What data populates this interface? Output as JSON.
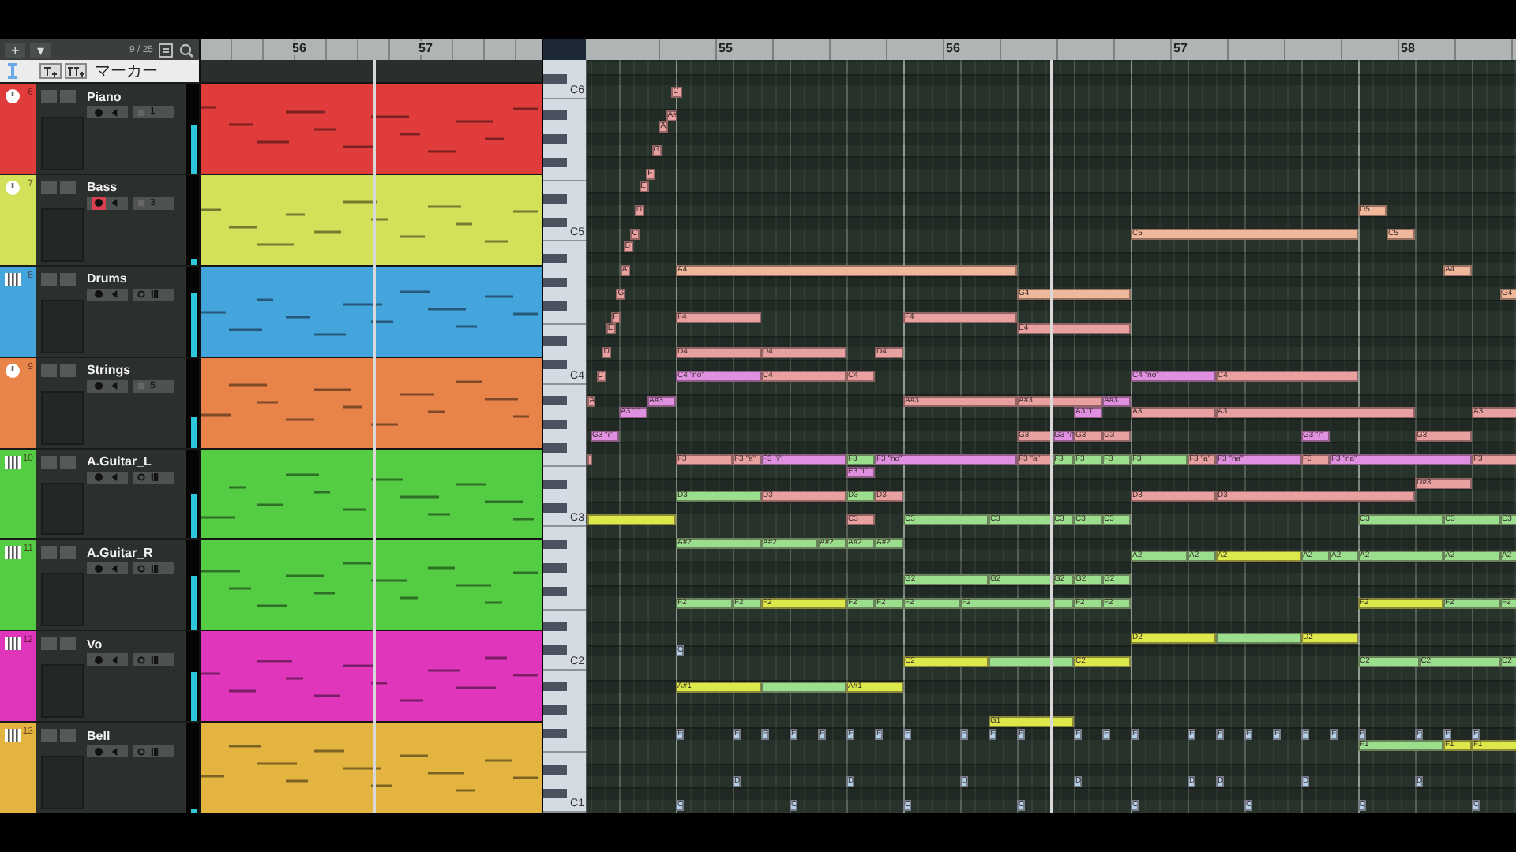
{
  "track_list": {
    "add_button": "+",
    "menu_button": "▾",
    "count": "9 / 25",
    "marker_track": {
      "name": "マーカー"
    },
    "tracks": [
      {
        "number": "6",
        "name": "Piano",
        "kind": "instrument",
        "color": "#e03c3c",
        "record": false,
        "channel": "1",
        "level": 0.55
      },
      {
        "number": "7",
        "name": "Bass",
        "kind": "instrument",
        "color": "#d2e05a",
        "record": true,
        "channel": "3",
        "level": 0.06
      },
      {
        "number": "8",
        "name": "Drums",
        "kind": "midi",
        "color": "#44a4dc",
        "record": false,
        "level": 0.7
      },
      {
        "number": "9",
        "name": "Strings",
        "kind": "instrument",
        "color": "#e8844a",
        "record": false,
        "channel": "5",
        "level": 0.35
      },
      {
        "number": "10",
        "name": "A.Guitar_L",
        "kind": "midi",
        "color": "#54cc44",
        "record": false,
        "level": 0.5
      },
      {
        "number": "11",
        "name": "A.Guitar_R",
        "kind": "midi",
        "color": "#54cc44",
        "record": false,
        "level": 0.6
      },
      {
        "number": "12",
        "name": "Vo",
        "kind": "midi",
        "color": "#e036bc",
        "record": false,
        "level": 0.55
      },
      {
        "number": "13",
        "name": "Bell",
        "kind": "midi",
        "color": "#e4b440",
        "record": false,
        "level": 0.04
      }
    ]
  },
  "arrangement": {
    "ruler": [
      "56",
      "57"
    ]
  },
  "piano_roll": {
    "ruler": [
      "55",
      "56",
      "57",
      "58"
    ],
    "keyboard": [
      "C6",
      "C5",
      "C4",
      "C3",
      "C2",
      "C1"
    ],
    "notes": [
      {
        "label": "C",
        "color": "#e8a0a0"
      },
      {
        "label": "A#",
        "color": "#e8a0a0"
      },
      {
        "label": "A",
        "color": "#e8a0a0"
      },
      {
        "label": "G",
        "color": "#e8a0a0"
      },
      {
        "label": "F",
        "color": "#e8a0a0"
      },
      {
        "label": "E",
        "color": "#e8a0a0"
      },
      {
        "label": "D",
        "color": "#e8a0a0"
      },
      {
        "label": "D5",
        "color": "#f0b89a"
      },
      {
        "label": "C",
        "color": "#e8a0a0"
      },
      {
        "label": "C5",
        "color": "#f0b89a"
      },
      {
        "label": "C5",
        "color": "#f0b89a"
      },
      {
        "label": "B",
        "color": "#e8a0a0"
      },
      {
        "label": "A",
        "color": "#e8a0a0"
      },
      {
        "label": "A4",
        "color": "#f0b89a"
      },
      {
        "label": "A4",
        "color": "#f0b89a"
      },
      {
        "label": "G",
        "color": "#e8a0a0"
      },
      {
        "label": "G4",
        "color": "#f0b89a"
      },
      {
        "label": "G4",
        "color": "#f0b89a"
      },
      {
        "label": "F",
        "color": "#e8a0a0"
      },
      {
        "label": "F4",
        "color": "#e8a0a0"
      },
      {
        "label": "F4",
        "color": "#e8a0a0"
      },
      {
        "label": "E",
        "color": "#e8a0a0"
      },
      {
        "label": "E4",
        "color": "#e8a0a0"
      },
      {
        "label": "D",
        "color": "#e8a0a0"
      },
      {
        "label": "D4",
        "color": "#e8a0a0"
      },
      {
        "label": "D4",
        "color": "#e8a0a0"
      },
      {
        "label": "D4",
        "color": "#e8a0a0"
      },
      {
        "label": "C",
        "color": "#e8a0a0"
      },
      {
        "label": "C4 \"no\"",
        "color": "#e090e0"
      },
      {
        "label": "C4",
        "color": "#e8a0a0"
      },
      {
        "label": "C4",
        "color": "#e8a0a0"
      },
      {
        "label": "C4 \"no\"",
        "color": "#e090e0"
      },
      {
        "label": "C4",
        "color": "#e8a0a0"
      },
      {
        "label": "A",
        "color": "#e8a0a0"
      },
      {
        "label": "A#3",
        "color": "#e090e0"
      },
      {
        "label": "A#3",
        "color": "#e8a0a0"
      },
      {
        "label": "A#3",
        "color": "#e8a0a0"
      },
      {
        "label": "A#3",
        "color": "#e090e0"
      },
      {
        "label": "A3 \"i\"",
        "color": "#e090e0"
      },
      {
        "label": "A3 \"i\"",
        "color": "#e090e0"
      },
      {
        "label": "A3",
        "color": "#e8a0a0"
      },
      {
        "label": "A3",
        "color": "#e8a0a0"
      },
      {
        "label": "A3",
        "color": "#e8a0a0"
      },
      {
        "label": "G3 \"i\"",
        "color": "#e090e0"
      },
      {
        "label": "G3",
        "color": "#e8a0a0"
      },
      {
        "label": "G3 \"i\"",
        "color": "#e090e0"
      },
      {
        "label": "G3",
        "color": "#e8a0a0"
      },
      {
        "label": "G3",
        "color": "#e8a0a0"
      },
      {
        "label": "G3 \"i\"",
        "color": "#e090e0"
      },
      {
        "label": "G3",
        "color": "#e8a0a0"
      },
      {
        "color": "#e8a0a0"
      },
      {
        "label": "F3",
        "color": "#e8a0a0"
      },
      {
        "label": "F3 \"a\"",
        "color": "#e8a0a0"
      },
      {
        "label": "F3 \"i\"",
        "color": "#e090e0"
      },
      {
        "label": "F3",
        "color": "#9ade8e"
      },
      {
        "label": "F3 \"no\"",
        "color": "#e090e0"
      },
      {
        "label": "F3 \"a\"",
        "color": "#e8a0a0"
      },
      {
        "label": "F3",
        "color": "#9ade8e"
      },
      {
        "label": "F3",
        "color": "#9ade8e"
      },
      {
        "label": "F3",
        "color": "#9ade8e"
      },
      {
        "label": "F3",
        "color": "#9ade8e"
      },
      {
        "label": "F3 \"a\"",
        "color": "#e8a0a0"
      },
      {
        "label": "F3 \"na\"",
        "color": "#e090e0"
      },
      {
        "label": "F3",
        "color": "#e8a0a0"
      },
      {
        "label": "F3 \"na\"",
        "color": "#e090e0"
      },
      {
        "label": "F3",
        "color": "#e8a0a0"
      },
      {
        "label": "E3 \"i\"",
        "color": "#e090e0"
      },
      {
        "label": "D#3",
        "color": "#e8a0a0"
      },
      {
        "label": "D3",
        "color": "#9ade8e"
      },
      {
        "label": "D3",
        "color": "#e8a0a0"
      },
      {
        "label": "D3",
        "color": "#9ade8e"
      },
      {
        "label": "D3",
        "color": "#e8a0a0"
      },
      {
        "label": "D3",
        "color": "#e8a0a0"
      },
      {
        "label": "D3",
        "color": "#e8a0a0"
      },
      {
        "color": "#dde84a"
      },
      {
        "label": "C3",
        "color": "#e8a0a0"
      },
      {
        "label": "C3",
        "color": "#9ade8e"
      },
      {
        "label": "C3",
        "color": "#9ade8e"
      },
      {
        "label": "C3",
        "color": "#9ade8e"
      },
      {
        "label": "C3",
        "color": "#9ade8e"
      },
      {
        "label": "C3",
        "color": "#9ade8e"
      },
      {
        "label": "C3",
        "color": "#9ade8e"
      },
      {
        "label": "C3",
        "color": "#9ade8e"
      },
      {
        "label": "C3",
        "color": "#9ade8e"
      },
      {
        "label": "A#2",
        "color": "#9ade8e"
      },
      {
        "label": "A#2",
        "color": "#9ade8e"
      },
      {
        "label": "A#2",
        "color": "#9ade8e"
      },
      {
        "label": "A#2",
        "color": "#9ade8e"
      },
      {
        "label": "A#2",
        "color": "#9ade8e"
      },
      {
        "label": "A2",
        "color": "#9ade8e"
      },
      {
        "label": "A2",
        "color": "#9ade8e"
      },
      {
        "label": "A2",
        "color": "#dde84a"
      },
      {
        "label": "A2",
        "color": "#9ade8e"
      },
      {
        "label": "A2",
        "color": "#9ade8e"
      },
      {
        "label": "A2",
        "color": "#9ade8e"
      },
      {
        "label": "A2",
        "color": "#9ade8e"
      },
      {
        "label": "A2",
        "color": "#9ade8e"
      },
      {
        "label": "G2",
        "color": "#9ade8e"
      },
      {
        "label": "G2",
        "color": "#9ade8e"
      },
      {
        "label": "G2",
        "color": "#9ade8e"
      },
      {
        "label": "G2",
        "color": "#9ade8e"
      },
      {
        "label": "G2",
        "color": "#9ade8e"
      },
      {
        "label": "F2",
        "color": "#9ade8e"
      },
      {
        "label": "F2",
        "color": "#9ade8e"
      },
      {
        "label": "F2",
        "color": "#dde84a"
      },
      {
        "label": "F2",
        "color": "#9ade8e"
      },
      {
        "label": "F2",
        "color": "#9ade8e"
      },
      {
        "label": "F2",
        "color": "#9ade8e"
      },
      {
        "label": "F2",
        "color": "#9ade8e"
      },
      {
        "color": "#9ade8e"
      },
      {
        "label": "F2",
        "color": "#9ade8e"
      },
      {
        "label": "F2",
        "color": "#9ade8e"
      },
      {
        "label": "F2",
        "color": "#dde84a"
      },
      {
        "label": "F2",
        "color": "#9ade8e"
      },
      {
        "label": "F2",
        "color": "#9ade8e"
      },
      {
        "label": "D2",
        "color": "#dde84a"
      },
      {
        "color": "#9ade8e"
      },
      {
        "label": "D2",
        "color": "#dde84a"
      },
      {
        "label": "C",
        "color": "#b4d0e8"
      },
      {
        "label": "C2",
        "color": "#dde84a"
      },
      {
        "color": "#9ade8e"
      },
      {
        "label": "C2",
        "color": "#dde84a"
      },
      {
        "label": "C2",
        "color": "#9ade8e"
      },
      {
        "label": "C2",
        "color": "#9ade8e"
      },
      {
        "label": "C2",
        "color": "#9ade8e"
      },
      {
        "label": "A#1",
        "color": "#dde84a"
      },
      {
        "color": "#9ade8e"
      },
      {
        "label": "A#1",
        "color": "#dde84a"
      },
      {
        "label": "G1",
        "color": "#dde84a"
      },
      {
        "label": "F",
        "color": "#b4d0e8"
      },
      {
        "label": "F",
        "color": "#b4d0e8"
      },
      {
        "label": "F",
        "color": "#b4d0e8"
      },
      {
        "label": "F",
        "color": "#b4d0e8"
      },
      {
        "label": "F",
        "color": "#b4d0e8"
      },
      {
        "label": "F",
        "color": "#b4d0e8"
      },
      {
        "label": "F",
        "color": "#b4d0e8"
      },
      {
        "label": "F",
        "color": "#b4d0e8"
      },
      {
        "label": "F",
        "color": "#b4d0e8"
      },
      {
        "label": "F",
        "color": "#b4d0e8"
      },
      {
        "label": "F",
        "color": "#b4d0e8"
      },
      {
        "label": "F",
        "color": "#b4d0e8"
      },
      {
        "label": "F",
        "color": "#b4d0e8"
      },
      {
        "label": "F",
        "color": "#b4d0e8"
      },
      {
        "label": "F",
        "color": "#b4d0e8"
      },
      {
        "label": "F",
        "color": "#b4d0e8"
      },
      {
        "label": "F",
        "color": "#b4d0e8"
      },
      {
        "label": "F",
        "color": "#b4d0e8"
      },
      {
        "label": "F",
        "color": "#b4d0e8"
      },
      {
        "label": "F",
        "color": "#b4d0e8"
      },
      {
        "label": "F",
        "color": "#b4d0e8"
      },
      {
        "label": "F",
        "color": "#b4d0e8"
      },
      {
        "label": "F",
        "color": "#b4d0e8"
      },
      {
        "label": "F",
        "color": "#b4d0e8"
      },
      {
        "label": "F1",
        "color": "#9ade8e"
      },
      {
        "label": "F1",
        "color": "#dde84a"
      },
      {
        "label": "F1",
        "color": "#dde84a"
      },
      {
        "label": "D",
        "color": "#b4d0e8"
      },
      {
        "label": "D",
        "color": "#b4d0e8"
      },
      {
        "label": "D",
        "color": "#b4d0e8"
      },
      {
        "label": "D",
        "color": "#b4d0e8"
      },
      {
        "label": "D",
        "color": "#b4d0e8"
      },
      {
        "label": "D",
        "color": "#b4d0e8"
      },
      {
        "label": "D",
        "color": "#b4d0e8"
      },
      {
        "label": "D",
        "color": "#b4d0e8"
      },
      {
        "label": "C",
        "color": "#b4d0e8"
      },
      {
        "label": "C",
        "color": "#b4d0e8"
      },
      {
        "label": "C",
        "color": "#b4d0e8"
      },
      {
        "label": "C",
        "color": "#b4d0e8"
      },
      {
        "label": "C",
        "color": "#b4d0e8"
      },
      {
        "label": "C",
        "color": "#b4d0e8"
      },
      {
        "label": "C",
        "color": "#b4d0e8"
      },
      {
        "label": "C",
        "color": "#b4d0e8"
      }
    ]
  }
}
